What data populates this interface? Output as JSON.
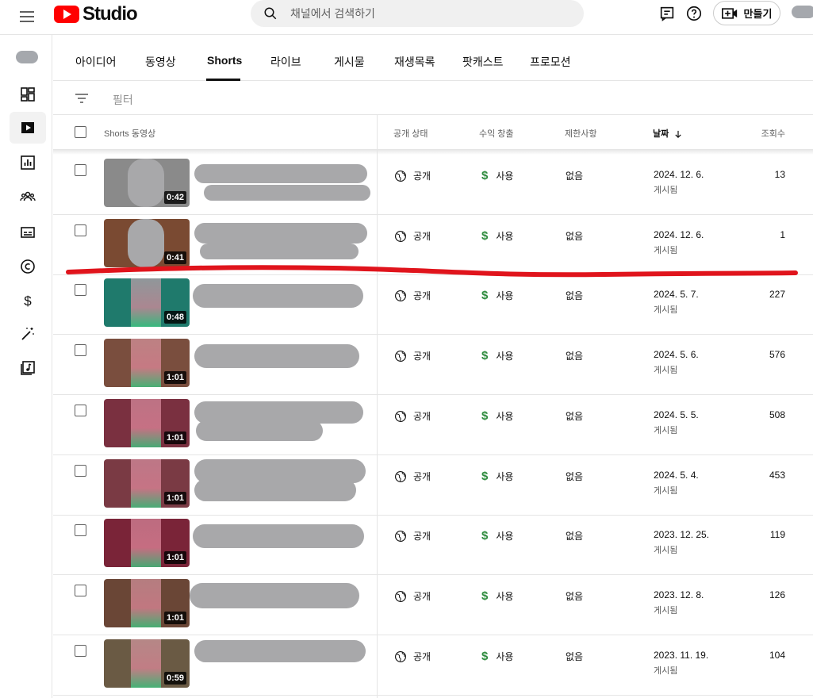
{
  "header": {
    "logo_text": "Studio",
    "search_placeholder": "채널에서 검색하기",
    "create_label": "만들기"
  },
  "tabs": [
    {
      "label": "아이디어",
      "active": false
    },
    {
      "label": "동영상",
      "active": false
    },
    {
      "label": "Shorts",
      "active": true
    },
    {
      "label": "라이브",
      "active": false
    },
    {
      "label": "게시물",
      "active": false
    },
    {
      "label": "재생목록",
      "active": false
    },
    {
      "label": "팟캐스트",
      "active": false
    },
    {
      "label": "프로모션",
      "active": false
    }
  ],
  "filter": {
    "label": "필터"
  },
  "table": {
    "headers": {
      "video": "Shorts 동영상",
      "visibility": "공개 상태",
      "monetization": "수익 창출",
      "restrictions": "제한사항",
      "date": "날짜",
      "views": "조회수"
    },
    "rows": [
      {
        "duration": "0:42",
        "visibility": "공개",
        "monetization": "사용",
        "restrictions": "없음",
        "date": "2024. 12. 6.",
        "status": "게시됨",
        "views": "13"
      },
      {
        "duration": "0:41",
        "visibility": "공개",
        "monetization": "사용",
        "restrictions": "없음",
        "date": "2024. 12. 6.",
        "status": "게시됨",
        "views": "1"
      },
      {
        "duration": "0:48",
        "visibility": "공개",
        "monetization": "사용",
        "restrictions": "없음",
        "date": "2024. 5. 7.",
        "status": "게시됨",
        "views": "227"
      },
      {
        "duration": "1:01",
        "visibility": "공개",
        "monetization": "사용",
        "restrictions": "없음",
        "date": "2024. 5. 6.",
        "status": "게시됨",
        "views": "576"
      },
      {
        "duration": "1:01",
        "visibility": "공개",
        "monetization": "사용",
        "restrictions": "없음",
        "date": "2024. 5. 5.",
        "status": "게시됨",
        "views": "508"
      },
      {
        "duration": "1:01",
        "visibility": "공개",
        "monetization": "사용",
        "restrictions": "없음",
        "date": "2024. 5. 4.",
        "status": "게시됨",
        "views": "453"
      },
      {
        "duration": "1:01",
        "visibility": "공개",
        "monetization": "사용",
        "restrictions": "없음",
        "date": "2023. 12. 25.",
        "status": "게시됨",
        "views": "119"
      },
      {
        "duration": "1:01",
        "visibility": "공개",
        "monetization": "사용",
        "restrictions": "없음",
        "date": "2023. 12. 8.",
        "status": "게시됨",
        "views": "126"
      },
      {
        "duration": "0:59",
        "visibility": "공개",
        "monetization": "사용",
        "restrictions": "없음",
        "date": "2023. 11. 19.",
        "status": "게시됨",
        "views": "104"
      }
    ]
  },
  "colors": {
    "accent_red": "#ff0000",
    "annotation_red": "#e0141c",
    "monetization_green": "#2e8b3e",
    "redaction_gray": "#a8a8aa",
    "thumbnails": [
      "#8a8a8a",
      "#7a4a32",
      "#1f7a6c",
      "#7a4e3e",
      "#7a3040",
      "#7a3a44",
      "#7a2438",
      "#6a4636",
      "#6a5a44"
    ]
  }
}
